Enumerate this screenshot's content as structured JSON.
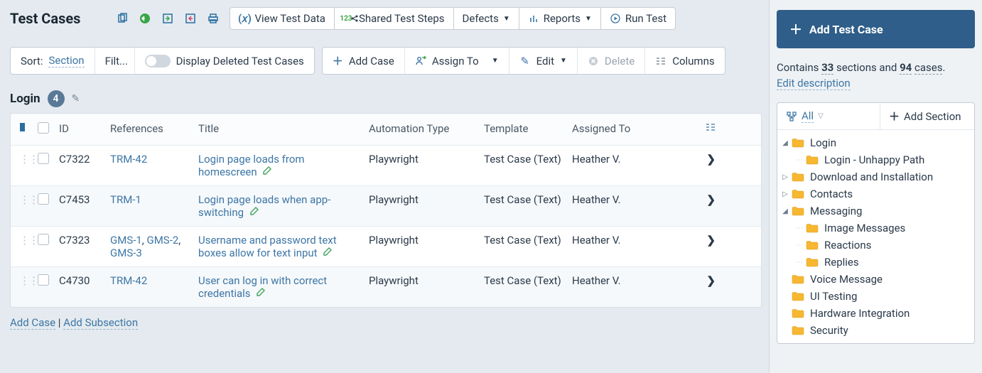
{
  "header": {
    "title": "Test Cases",
    "buttons": {
      "view_data": "View Test Data",
      "shared_steps": "Shared Test Steps",
      "defects": "Defects",
      "reports": "Reports",
      "run_test": "Run Test"
    }
  },
  "toolbar": {
    "sort_prefix": "Sort:",
    "sort_value": "Section",
    "filter": "Filt...",
    "toggle_label": "Display Deleted Test Cases",
    "add_case": "Add Case",
    "assign_to": "Assign To",
    "edit": "Edit",
    "delete": "Delete",
    "columns": "Columns"
  },
  "section": {
    "name": "Login",
    "count": "4"
  },
  "columns": {
    "id": "ID",
    "refs": "References",
    "title": "Title",
    "autotype": "Automation Type",
    "template": "Template",
    "assigned": "Assigned To"
  },
  "rows": [
    {
      "id": "C7322",
      "refs": [
        "TRM-42"
      ],
      "title": "Login page loads from homescreen",
      "auto": "Playwright",
      "tmpl": "Test Case (Text)",
      "assigned": "Heather V."
    },
    {
      "id": "C7453",
      "refs": [
        "TRM-1"
      ],
      "title": "Login page loads when app-switching",
      "auto": "Playwright",
      "tmpl": "Test Case (Text)",
      "assigned": "Heather V."
    },
    {
      "id": "C7323",
      "refs": [
        "GMS-1",
        "GMS-2",
        "GMS-3"
      ],
      "title": "Username and password text boxes allow for text input",
      "auto": "Playwright",
      "tmpl": "Test Case (Text)",
      "assigned": "Heather V."
    },
    {
      "id": "C4730",
      "refs": [
        "TRM-42"
      ],
      "title": "User can log in with correct credentials",
      "auto": "Playwright",
      "tmpl": "Test Case (Text)",
      "assigned": "Heather V."
    }
  ],
  "footer": {
    "add_case": "Add Case",
    "add_subsection": "Add Subsection"
  },
  "sidebar": {
    "add_btn": "Add Test Case",
    "contains_a": "Contains",
    "contains_sections": "33",
    "contains_b": "sections and",
    "contains_cases": "94",
    "contains_c": "cases",
    "edit_desc": "Edit description",
    "treeheader": {
      "all": "All",
      "add_section": "Add Section"
    },
    "tree": [
      {
        "lvl": 1,
        "caret": "down",
        "label": "Login"
      },
      {
        "lvl": 2,
        "caret": "none",
        "label": "Login - Unhappy Path"
      },
      {
        "lvl": 1,
        "caret": "right",
        "label": "Download and Installation"
      },
      {
        "lvl": 1,
        "caret": "right",
        "label": "Contacts"
      },
      {
        "lvl": 1,
        "caret": "down",
        "label": "Messaging"
      },
      {
        "lvl": 2,
        "caret": "none",
        "label": "Image Messages"
      },
      {
        "lvl": 2,
        "caret": "none",
        "label": "Reactions"
      },
      {
        "lvl": 2,
        "caret": "none",
        "label": "Replies"
      },
      {
        "lvl": 1,
        "caret": "blank",
        "label": "Voice Message"
      },
      {
        "lvl": 1,
        "caret": "blank",
        "label": "UI Testing"
      },
      {
        "lvl": 1,
        "caret": "blank",
        "label": "Hardware Integration"
      },
      {
        "lvl": 1,
        "caret": "blank",
        "label": "Security"
      }
    ]
  }
}
